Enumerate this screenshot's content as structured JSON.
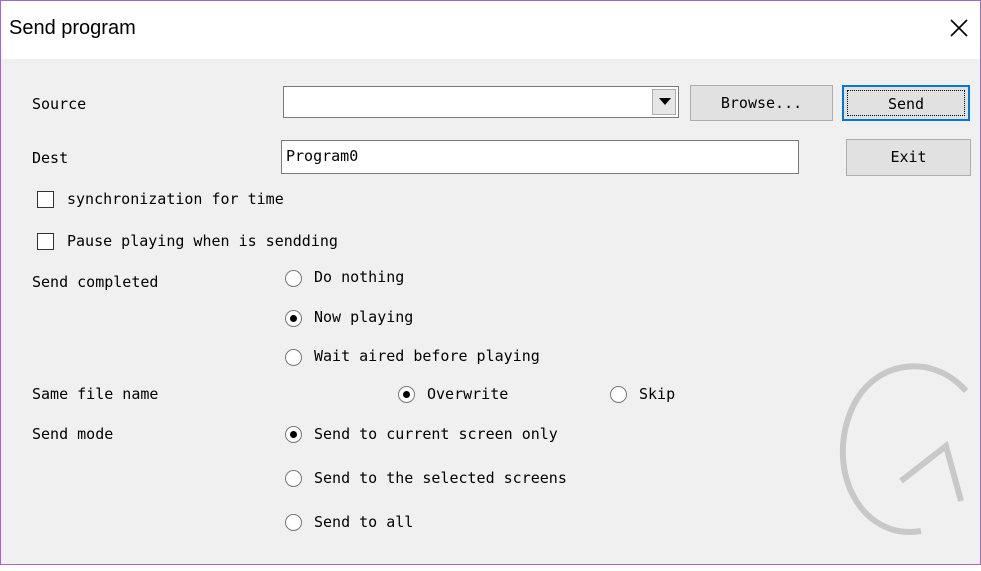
{
  "window": {
    "title": "Send program"
  },
  "source": {
    "label": "Source",
    "value": "",
    "browse_label": "Browse...",
    "send_label": "Send"
  },
  "dest": {
    "label": "Dest",
    "value": "Program0",
    "exit_label": "Exit"
  },
  "options": {
    "sync_label": "synchronization for time",
    "sync_checked": false,
    "pause_label": "Pause playing when is sendding",
    "pause_checked": false
  },
  "send_completed": {
    "label": "Send completed",
    "choices": [
      "Do nothing",
      "Now playing",
      "Wait aired before playing"
    ],
    "selected": 1
  },
  "same_file": {
    "label": "Same file name",
    "choices": [
      "Overwrite",
      "Skip"
    ],
    "selected": 0
  },
  "send_mode": {
    "label": "Send mode",
    "choices": [
      "Send to current screen only",
      "Send to the selected screens",
      "Send to all"
    ],
    "selected": 0
  },
  "icons": {
    "close": "close-icon",
    "dropdown": "chevron-down-icon"
  }
}
